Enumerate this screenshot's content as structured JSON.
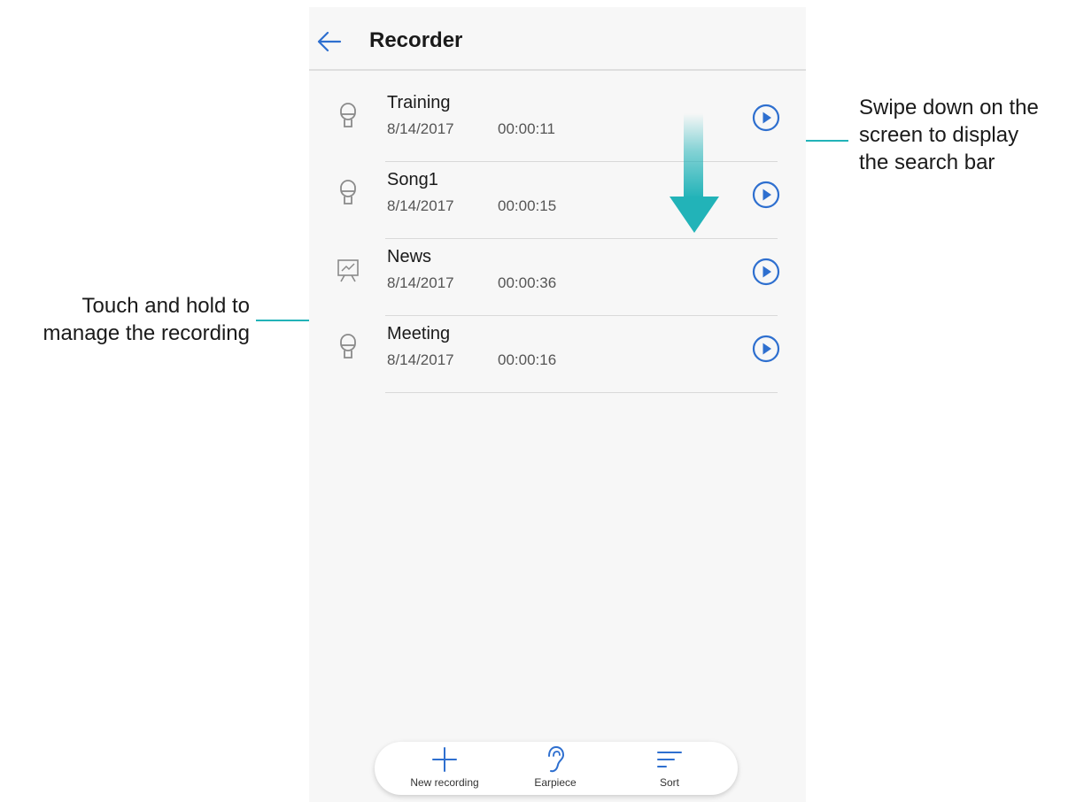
{
  "header": {
    "title": "Recorder"
  },
  "recordings": [
    {
      "name": "Training",
      "date": "8/14/2017",
      "duration": "00:00:11",
      "icon": "microphone-icon"
    },
    {
      "name": "Song1",
      "date": "8/14/2017",
      "duration": "00:00:15",
      "icon": "microphone-icon"
    },
    {
      "name": "News",
      "date": "8/14/2017",
      "duration": "00:00:36",
      "icon": "presentation-icon"
    },
    {
      "name": "Meeting",
      "date": "8/14/2017",
      "duration": "00:00:16",
      "icon": "microphone-icon"
    }
  ],
  "toolbar": {
    "new_recording_label": "New recording",
    "earpiece_label": "Earpiece",
    "sort_label": "Sort"
  },
  "annotations": {
    "swipe_line1": "Swipe down on the",
    "swipe_line2": "screen to display",
    "swipe_line3": "the search bar",
    "hold_line1": "Touch and hold to",
    "hold_line2": "manage the recording"
  },
  "colors": {
    "accent_blue": "#2e6fcf",
    "annotation_teal": "#22b3b8",
    "background": "#f7f7f7"
  }
}
